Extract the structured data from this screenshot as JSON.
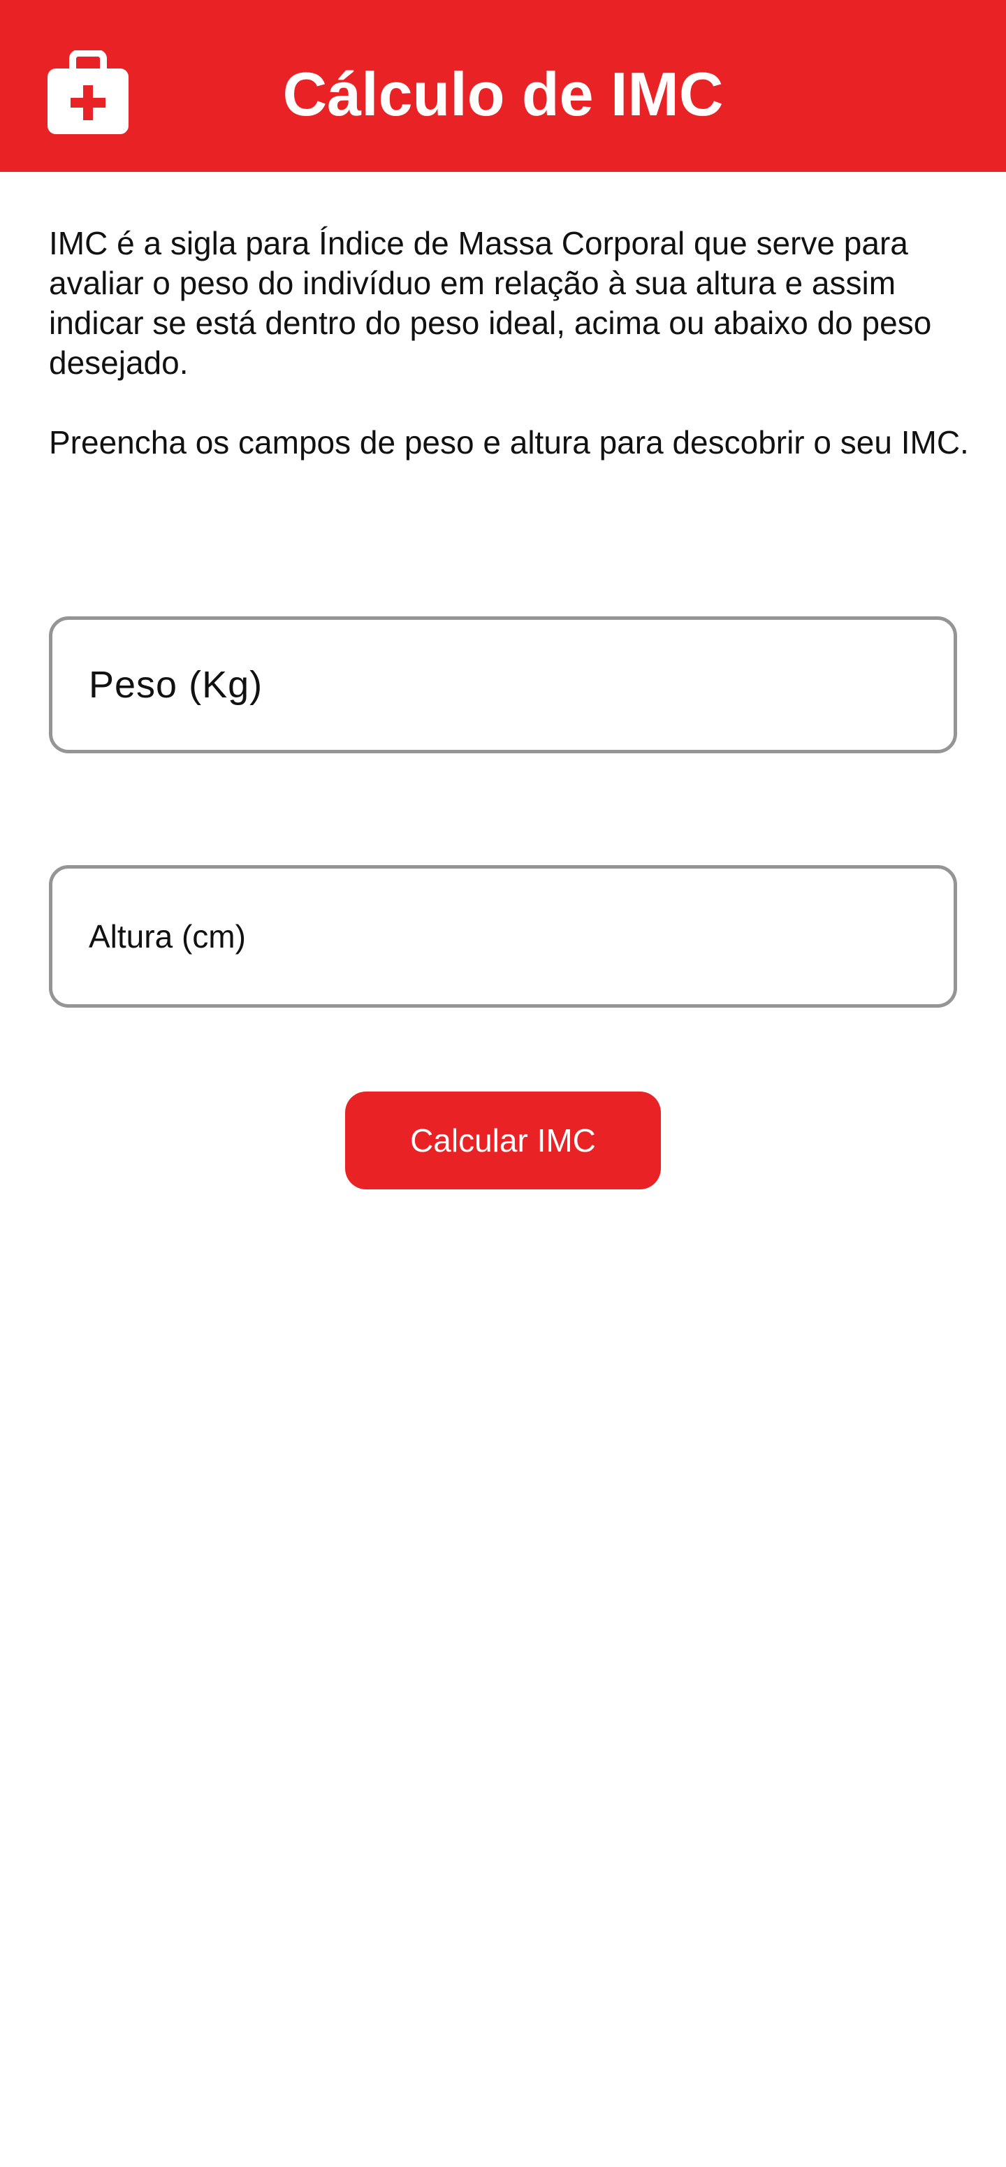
{
  "app_bar": {
    "title": "Cálculo de IMC",
    "icon": "medical-kit-icon",
    "background_color": "#e92225"
  },
  "description": {
    "paragraph_1": "IMC é a sigla para Índice de Massa Corporal que serve para avaliar o peso do indivíduo em relação à sua altura e assim indicar se está dentro do peso ideal, acima ou abaixo do peso desejado.",
    "paragraph_2": "Preencha os campos de peso e altura para descobrir o seu IMC."
  },
  "form": {
    "weight_placeholder": "Peso (Kg)",
    "weight_value": "",
    "height_placeholder": "Altura (cm)",
    "height_value": "",
    "submit_label": "Calcular IMC"
  },
  "colors": {
    "accent": "#e92225",
    "field_border": "#959595",
    "text": "#111111"
  }
}
